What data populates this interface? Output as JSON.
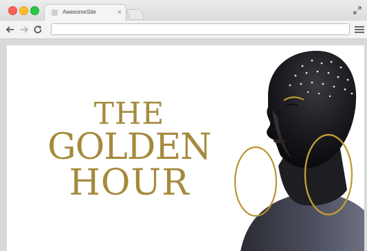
{
  "browser": {
    "tab_title": "AwesomeSite",
    "tab_close": "×",
    "address_value": "",
    "icons": {
      "back": "arrow-left-icon",
      "forward": "arrow-right-icon",
      "reload": "reload-icon",
      "menu": "hamburger-menu-icon",
      "fullscreen": "expand-icon"
    }
  },
  "page": {
    "title_line_1": "THE",
    "title_line_2": "GOLDEN",
    "title_line_3": "HOUR",
    "title_color": "#a58a3c"
  }
}
